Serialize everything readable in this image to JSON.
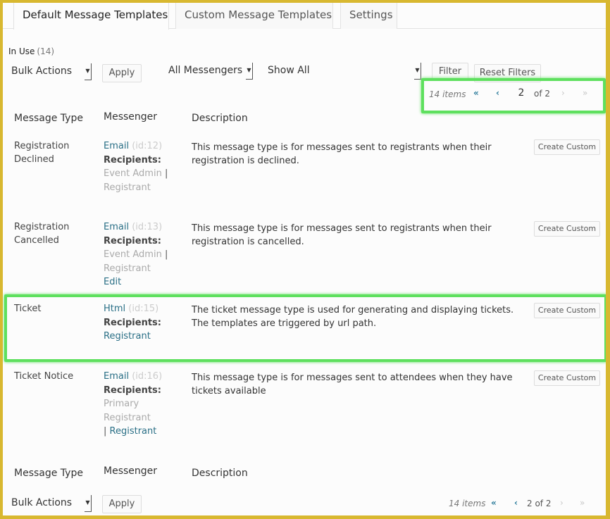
{
  "tabs": [
    {
      "label": "Default Message Templates",
      "active": true
    },
    {
      "label": "Custom Message Templates",
      "active": false
    },
    {
      "label": "Settings",
      "active": false
    }
  ],
  "status": {
    "label": "In Use",
    "count": "(14)"
  },
  "toolbar_top": {
    "bulk_actions": "Bulk Actions",
    "apply": "Apply",
    "messengers_filter": "All Messengers",
    "show_filter": "Show All",
    "filter": "Filter",
    "reset_filters": "Reset Filters"
  },
  "pagination_top": {
    "items": "14 items",
    "first": "«",
    "prev": "‹",
    "current_page": "2",
    "of_total": "of 2",
    "next": "›",
    "last": "»"
  },
  "columns": {
    "type": "Message Type",
    "messenger": "Messenger",
    "description": "Description"
  },
  "rows": [
    {
      "type_line1": "Registration",
      "type_line2": "Declined",
      "messenger": "Email",
      "id": "(id:12)",
      "recipients_label": "Recipients:",
      "recipients": [
        "Event Admin",
        "Registrant"
      ],
      "description": "This message type is for messages sent to registrants when their registration is declined.",
      "action": "Create Custom"
    },
    {
      "type_line1": "Registration",
      "type_line2": "Cancelled",
      "messenger": "Email",
      "id": "(id:13)",
      "recipients_label": "Recipients:",
      "recipients": [
        "Event Admin",
        "Registrant"
      ],
      "edit": "Edit",
      "description": "This message type is for messages sent to registrants when their registration is cancelled.",
      "action": "Create Custom"
    },
    {
      "type_line1": "Ticket",
      "messenger": "Html",
      "id": "(id:15)",
      "recipients_label": "Recipients:",
      "recipients": [
        "Registrant"
      ],
      "description": "The ticket message type is used for generating and displaying tickets. The templates are triggered by url path.",
      "action": "Create Custom"
    },
    {
      "type_line1": "Ticket Notice",
      "messenger": "Email",
      "id": "(id:16)",
      "recipients_label": "Recipients:",
      "recipients": [
        "Primary Registrant",
        "Registrant"
      ],
      "description": "This message type is for messages sent to attendees when they have tickets available",
      "action": "Create Custom"
    }
  ],
  "toolbar_bottom": {
    "bulk_actions": "Bulk Actions",
    "apply": "Apply"
  },
  "pagination_bottom": {
    "items": "14 items",
    "first": "«",
    "prev": "‹",
    "page_text": "2 of 2",
    "next": "›",
    "last": "»"
  },
  "colors": {
    "highlight": "#5ee05e",
    "link": "#2a6f86",
    "frame": "#d8b830"
  }
}
